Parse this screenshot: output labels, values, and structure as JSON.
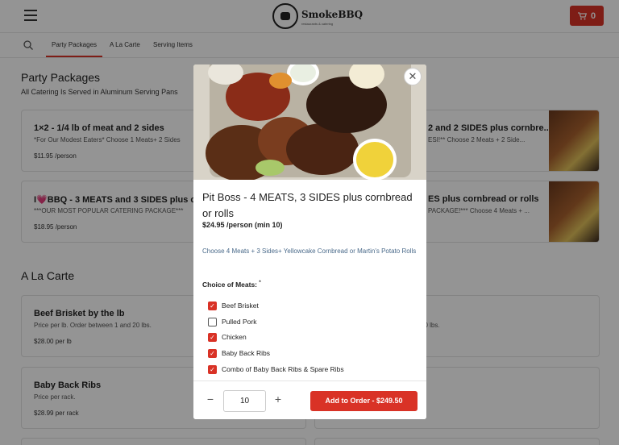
{
  "header": {
    "logo_text": "SmokeBBQ",
    "logo_tagline": "restaurants & catering",
    "cart_count": "0"
  },
  "tabs": [
    {
      "label": "Party Packages",
      "active": true
    },
    {
      "label": "A La Carte",
      "active": false
    },
    {
      "label": "Serving Items",
      "active": false
    }
  ],
  "party_packages": {
    "title": "Party Packages",
    "subtitle": "All Catering Is Served in Aluminum Serving Pans",
    "cards": [
      {
        "title": "1×2 - 1/4 lb of meat and 2 sides",
        "desc": "*For Our Modest Eaters* Choose 1 Meats+ 2 Sides",
        "price": "$11.95 /person"
      },
      {
        "title": "2 and 2 SIDES plus cornbre...",
        "desc": "ESI!** Choose 2 Meats + 2 Side...",
        "price": ""
      },
      {
        "title": "I💗BBQ - 3 MEATS and 3 SIDES plus corn",
        "desc": "***OUR MOST POPULAR CATERING PACKAGE***",
        "price": "$18.95 /person"
      },
      {
        "title": "ES plus cornbread or rolls",
        "desc": "PACKAGE!*** Choose 4 Meats + ...",
        "price": ""
      }
    ]
  },
  "a_la_carte": {
    "title": "A La Carte",
    "cards": [
      {
        "title": "Beef Brisket by the lb",
        "desc": "Price per lb. Order between 1 and 20 lbs.",
        "price": "$28.00 per lb"
      },
      {
        "title": "",
        "desc": "20 lbs.",
        "price": ""
      },
      {
        "title": "Baby Back Ribs",
        "desc": "Price per rack.",
        "price": "$28.99 per rack"
      }
    ]
  },
  "modal": {
    "title": "Pit Boss - 4 MEATS, 3 SIDES plus cornbread or rolls",
    "price": "$24.95 /person  (min 10)",
    "description": "Choose 4 Meats + 3 Sides+ Yellowcake Cornbread or Martin's Potato Rolls",
    "choice_label": "Choice of Meats:",
    "required_mark": "*",
    "options": [
      {
        "label": "Beef Brisket",
        "checked": true
      },
      {
        "label": "Pulled Pork",
        "checked": false
      },
      {
        "label": "Chicken",
        "checked": true
      },
      {
        "label": "Baby Back Ribs",
        "checked": true
      },
      {
        "label": "Combo of Baby Back Ribs & Spare Ribs",
        "checked": true
      }
    ],
    "quantity": "10",
    "add_button": "Add to Order - $249.50"
  },
  "colors": {
    "accent": "#d93226"
  }
}
